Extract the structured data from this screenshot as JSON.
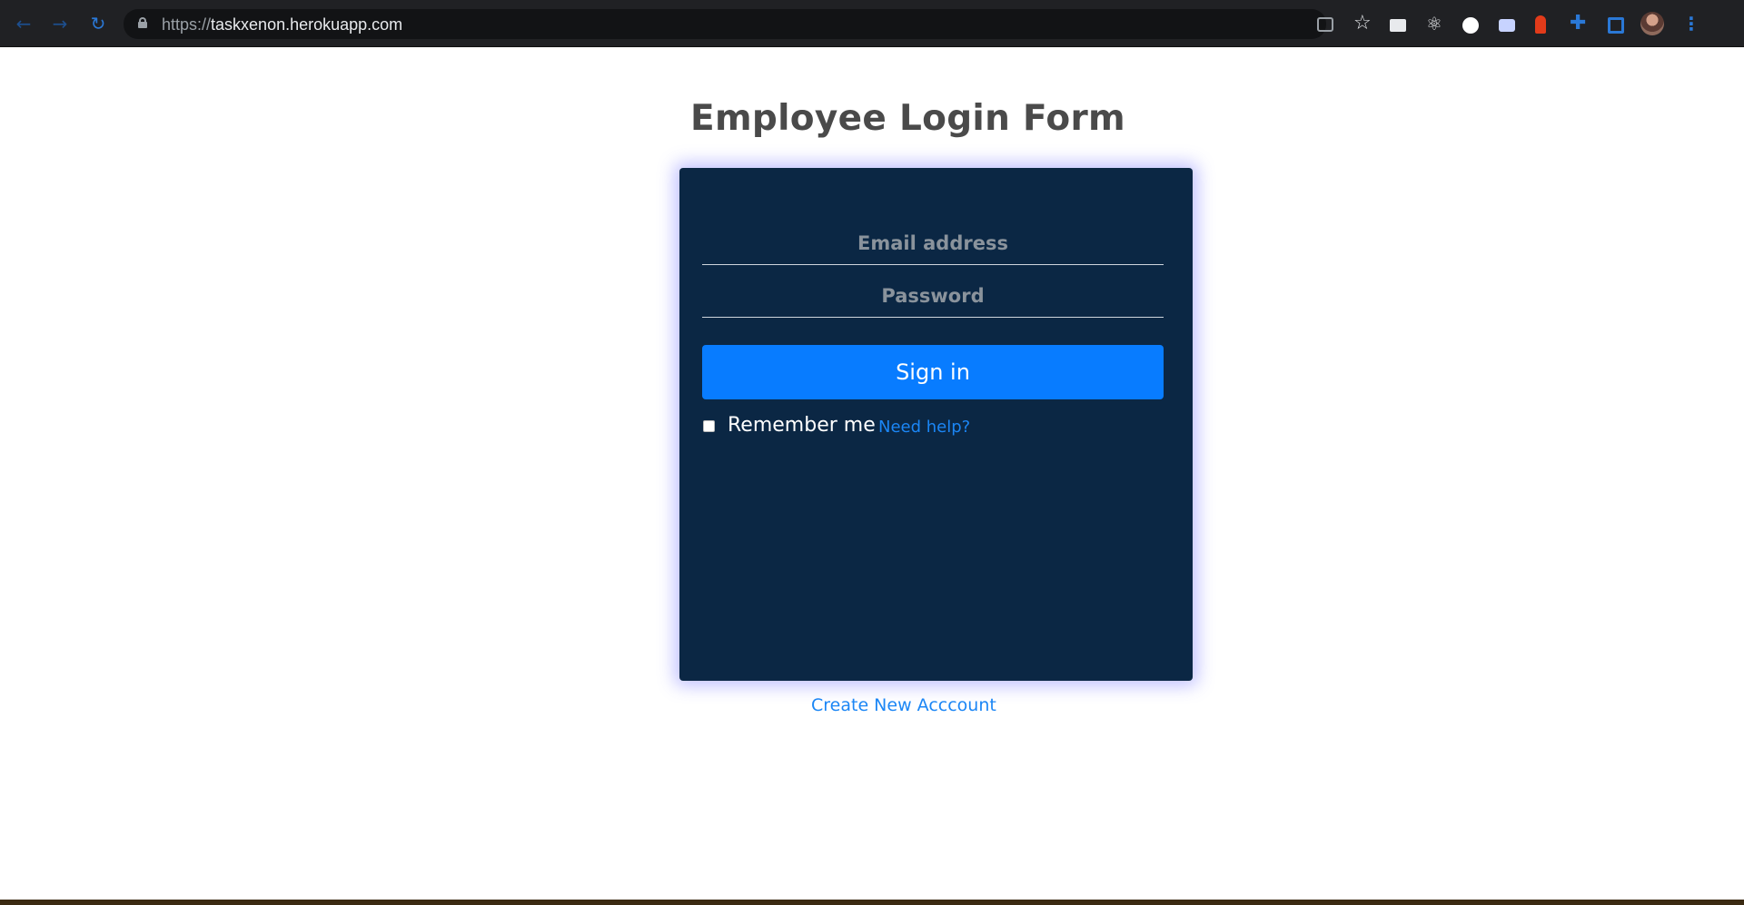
{
  "browser": {
    "url_scheme": "https://",
    "url_host": "taskxenon.herokuapp.com",
    "accent_color": "#2a78d6"
  },
  "page": {
    "title": "Employee Login Form"
  },
  "login_form": {
    "email_placeholder": "Email address",
    "email_value": "",
    "password_placeholder": "Password",
    "password_value": "",
    "signin_label": "Sign in",
    "remember_label": "Remember me",
    "remember_checked": false,
    "help_label": "Need help?",
    "card_color": "#0b2744",
    "button_color": "#087cff",
    "link_color": "#1b86f5"
  },
  "footer": {
    "create_account_label": "Create New Acccount"
  }
}
